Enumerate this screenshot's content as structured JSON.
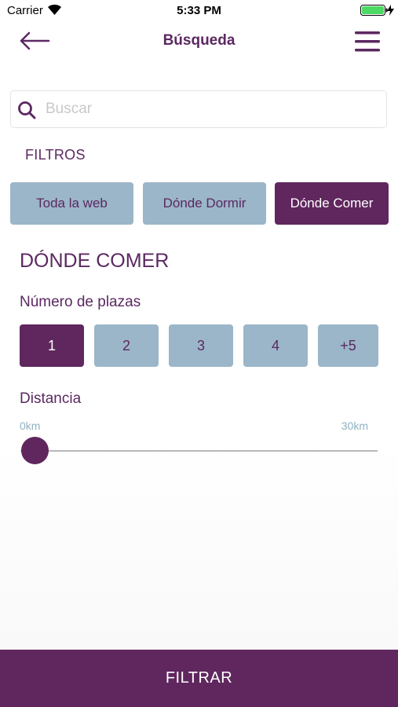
{
  "status_bar": {
    "carrier": "Carrier",
    "time": "5:33 PM",
    "battery_color": "#4cd964"
  },
  "nav": {
    "title": "Búsqueda",
    "back_icon": "arrow-left-icon",
    "menu_icon": "hamburger-menu-icon"
  },
  "search": {
    "placeholder": "Buscar",
    "value": ""
  },
  "filters": {
    "label": "FILTROS",
    "tabs": [
      {
        "label": "Toda la web",
        "active": false
      },
      {
        "label": "Dónde Dormir",
        "active": false
      },
      {
        "label": "Dónde Comer",
        "active": true
      }
    ]
  },
  "section": {
    "title": "DÓNDE COMER",
    "plazas_label": "Número de plazas",
    "plazas_options": [
      "1",
      "2",
      "3",
      "4",
      "+5"
    ],
    "plazas_selected": "1",
    "distance_label": "Distancia",
    "distance_min": "0km",
    "distance_max": "30km",
    "distance_value_fraction": 0.04
  },
  "footer": {
    "filter_button": "FILTRAR"
  },
  "colors": {
    "primary": "#5f275e",
    "secondary": "#9bb6c8",
    "text": "#5c2862",
    "muted": "#8fb2c2"
  }
}
